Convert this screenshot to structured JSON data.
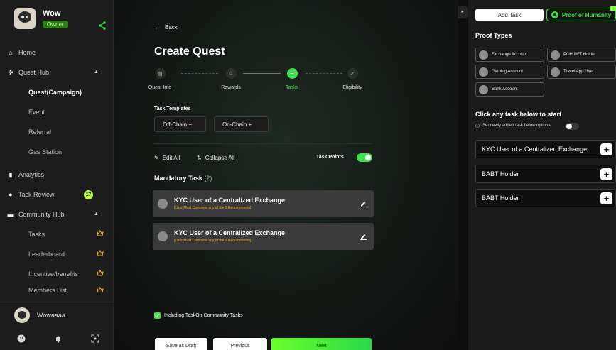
{
  "brand": {
    "name": "Wow",
    "role": "Owner"
  },
  "sidebar": {
    "items": [
      {
        "label": "Home"
      },
      {
        "label": "Quest Hub"
      },
      {
        "label": "Quest(Campaign)"
      },
      {
        "label": "Event"
      },
      {
        "label": "Referral"
      },
      {
        "label": "Gas Station"
      },
      {
        "label": "Analytics"
      },
      {
        "label": "Task Review",
        "badge": "17"
      },
      {
        "label": "Community Hub"
      },
      {
        "label": "Tasks"
      },
      {
        "label": "Leaderboard"
      },
      {
        "label": "Incentive/benefits"
      },
      {
        "label": "Members List"
      }
    ],
    "user_name": "Wowaaaa"
  },
  "main": {
    "back_label": "Back",
    "title": "Create Quest",
    "steps": [
      {
        "label": "Quest Info"
      },
      {
        "label": "Rewards"
      },
      {
        "label": "Tasks"
      },
      {
        "label": "Eligibility"
      }
    ],
    "task_templates_label": "Task Templates",
    "offchain_label": "Off-Chain  +",
    "onchain_label": "On-Chain  +",
    "edit_all_label": "Edit All",
    "collapse_all_label": "Collapse All",
    "task_points_label": "Task Points",
    "mandatory_label": "Mandatory Task",
    "mandatory_count": "(2)",
    "tasks": [
      {
        "name": "KYC User of a Centralized Exchange",
        "sub": "[User Must Complete any of the 3 Requirements]"
      },
      {
        "name": "KYC User of a Centralized Exchange",
        "sub": "[User Must Complete any of the 3 Requirements]"
      }
    ],
    "include_label": "Including TaskOn Community Tasks",
    "save_draft_label": "Save as Draft",
    "previous_label": "Previous",
    "next_label": "Next"
  },
  "right": {
    "add_task_label": "Add Task",
    "poh_label": "Proof of Humanity",
    "proof_types_label": "Proof Types",
    "proof_types": [
      {
        "label": "Exchange Account"
      },
      {
        "label": "POH NFT Holder"
      },
      {
        "label": "Gaming Account"
      },
      {
        "label": "Travel App User"
      },
      {
        "label": "Bank Account"
      }
    ],
    "click_label": "Click any task below to start",
    "optional_label": "Set newly added task below optional",
    "tasks": [
      {
        "label": "KYC User of a Centralized Exchange"
      },
      {
        "label": "BABT Holder"
      },
      {
        "label": "BABT Holder"
      }
    ]
  },
  "colors": {
    "accent": "#3ee14a",
    "warning_text": "#f0b323",
    "badge": "#b8ff3b"
  }
}
